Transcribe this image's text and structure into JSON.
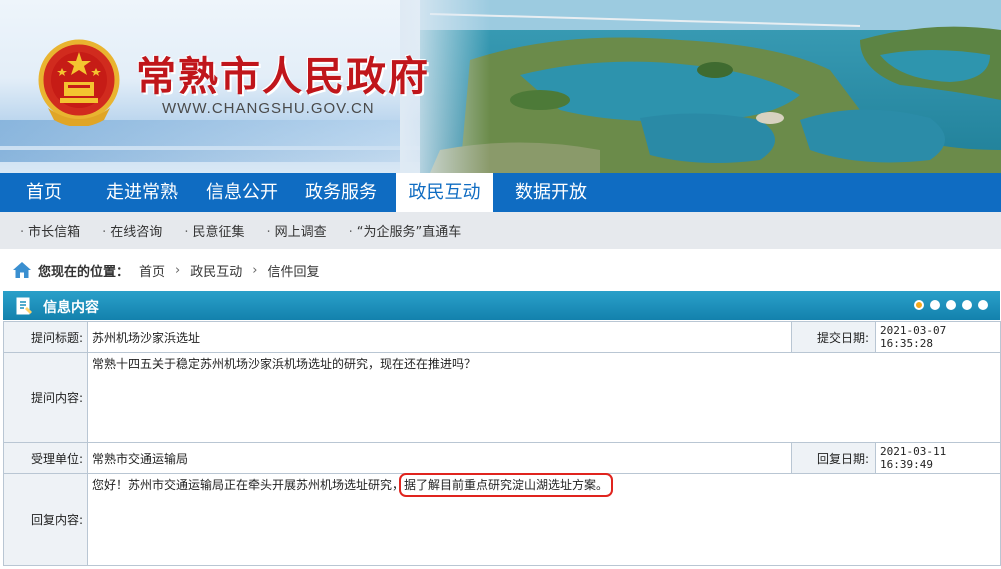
{
  "header": {
    "site_title": "常熟市人民政府",
    "site_url": "WWW.CHANGSHU.GOV.CN",
    "emblem_icon": "national-emblem-icon"
  },
  "main_nav": {
    "items": [
      {
        "label": "首页",
        "active": false
      },
      {
        "label": "走进常熟",
        "active": false
      },
      {
        "label": "信息公开",
        "active": false
      },
      {
        "label": "政务服务",
        "active": false
      },
      {
        "label": "政民互动",
        "active": true
      },
      {
        "label": "数据开放",
        "active": false
      }
    ]
  },
  "sub_nav": {
    "items": [
      "市长信箱",
      "在线咨询",
      "民意征集",
      "网上调查",
      "“为企服务”直通车"
    ]
  },
  "breadcrumb": {
    "label": "您现在的位置：",
    "items": [
      "首页",
      "政民互动",
      "信件回复"
    ],
    "icon": "home-icon"
  },
  "panel": {
    "title": "信息内容",
    "pager_dots": 5,
    "active_dot": 1
  },
  "letter": {
    "subject_label": "提问标题:",
    "subject": "苏州机场沙家浜选址",
    "submit_date_label": "提交日期:",
    "submit_date": "2021-03-07 16:35:28",
    "question_label": "提问内容:",
    "question": "常熟十四五关于稳定苏州机场沙家浜机场选址的研究，现在还在推进吗？",
    "dept_label": "受理单位:",
    "dept": "常熟市交通运输局",
    "reply_date_label": "回复日期:",
    "reply_date": "2021-03-11 16:39:49",
    "reply_label": "回复内容:",
    "reply_part1": "您好！苏州市交通运输局正在牵头开展苏州机场选址研究，",
    "reply_part2": "据了解目前重点研究淀山湖选址方案。"
  },
  "colors": {
    "nav_blue": "#0f6cc2",
    "title_red": "#c0161b",
    "panel_teal": "#1b8fbb",
    "highlight_red": "#e0241e"
  }
}
